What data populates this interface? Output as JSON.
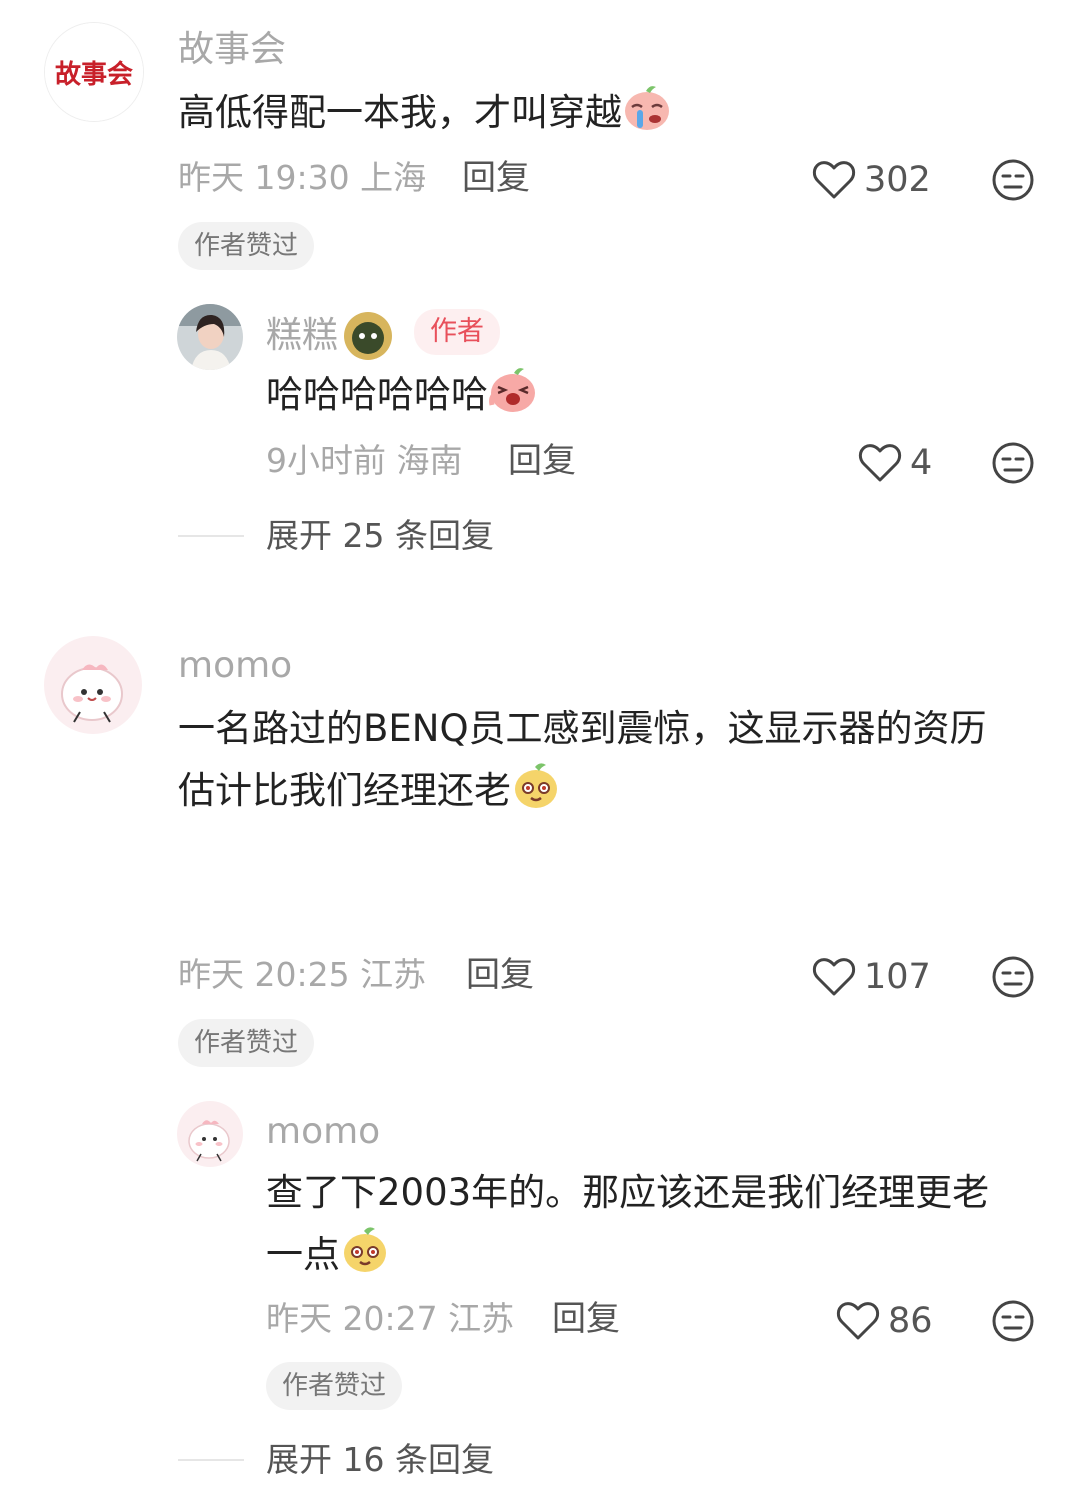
{
  "comments": [
    {
      "user": "故事会",
      "avatar_logo_text": "故事会",
      "text_lines": [
        "高低得配一本我，才叫穿越"
      ],
      "time": "昨天 19:30",
      "location": "上海",
      "reply_label": "回复",
      "likes": "302",
      "liked_badge": "作者赞过",
      "reply": {
        "user": "糕糕",
        "author_tag": "作者",
        "text": "哈哈哈哈哈哈",
        "time": "9小时前",
        "location": "海南",
        "reply_label": "回复",
        "likes": "4"
      },
      "expand_label": "展开 25 条回复"
    },
    {
      "user": "momo",
      "text_lines": [
        "一名路过的BENQ员工感到震惊，这显示器的资历",
        "估计比我们经理还老"
      ],
      "time": "昨天 20:25",
      "location": "江苏",
      "reply_label": "回复",
      "likes": "107",
      "liked_badge": "作者赞过",
      "reply": {
        "user": "momo",
        "text_lines": [
          "查了下2003年的。那应该还是我们经理更老",
          "一点"
        ],
        "time": "昨天 20:27",
        "location": "江苏",
        "reply_label": "回复",
        "likes": "86",
        "liked_badge": "作者赞过"
      },
      "expand_label": "展开 16 条回复"
    }
  ],
  "colors": {
    "muted_text": "#a8a8a8",
    "action_text": "#555555",
    "author_tag_bg": "#fdeff0",
    "author_tag_text": "#e8505b",
    "logo_red": "#c8202a"
  },
  "icons": [
    "heart-outline-icon",
    "dislike-face-icon",
    "crying-emoji",
    "laughing-emoji",
    "smug-emoji",
    "olive-badge-icon"
  ]
}
